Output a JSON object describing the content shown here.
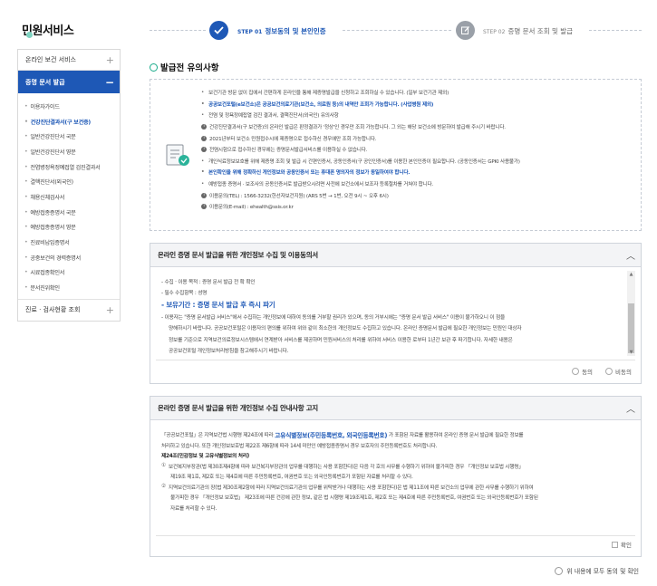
{
  "sidebar": {
    "title": "민원서비스",
    "sections": [
      {
        "label": "온라인 보건 서비스",
        "toggle": "+"
      },
      {
        "label": "증명 문서 발급",
        "toggle": "−"
      },
      {
        "label": "진료 · 검사현황 조회",
        "toggle": "+"
      }
    ],
    "sub_items": [
      "이용자가이드",
      "건강진단결과서(구 보건증)",
      "일반건강진단서 국문",
      "일반건강진단서 영문",
      "전염병정욕정예접열 검진결과서",
      "결핵진단서(외국인)",
      "채용신체검사서",
      "예방접종증명서 국문",
      "예방접종증명서 영문",
      "진료비납입증명서",
      "공중보건의 경력증명서",
      "시료접종확인서",
      "문서진위확인"
    ]
  },
  "steps": [
    {
      "num": "STEP 01",
      "label": "정보동의 및 본인인증"
    },
    {
      "num": "STEP 02",
      "label": "증명 문서 조회 및 발급"
    }
  ],
  "notice": {
    "title": "발급전 유의사항",
    "items": [
      {
        "mark": "•",
        "text": "보건기관 방문 없이 집에서 간편하게 온라인을 통해 제증명발급을 신청하고 조회하실 수 있습니다. (일부 보건기관 제외)"
      },
      {
        "mark": "•",
        "text": "공공보건포털(e보건소)은 공공보건의료기관(보건소, 의료원 등)의 내역만 조회가 가능합니다. (사업병원 제외)",
        "blue": true
      },
      {
        "mark": "•",
        "text": "전염 및 정욕정예접열 검진 결과서, 결핵진단서(외국인) 유의사항"
      },
      {
        "mark": "i",
        "text": "건강진단결과서(구 보건증)의 온라인 발급은 판정결과가 '정상'인 경우만 조회 가능합니다. 그 외는 해당 보건소에 방문하여 발급해 주시기 바랍니다."
      },
      {
        "mark": "i",
        "text": "2021년부터 보건소 민원접수시에 제증명으로 접수하신 경우에만 조회 가능합니다."
      },
      {
        "mark": "i",
        "text": "전염시험으로 접수하신 경우에는 증명문서발급서비스를 이용하실 수 없습니다."
      },
      {
        "mark": "•",
        "text": "개인식료정보보호를 위해 제증명 조회 및 발급 시 간편인증서, 공동인증서(구 공인인증서)를 이용한 본인인증이 필요합니다. (공동인증서는 GPKI 사용불가)"
      },
      {
        "mark": "•",
        "text": "본인확인을 위해 정확하신 개인정보와 공동인증서 또는 휴대폰 명의자의 정보가 동일하여야 합니다.",
        "blue": true
      },
      {
        "mark": "•",
        "text": "예방접종 증명서 · 보조사의 공동인증서로 발급받으시려면 사전에 보건소에서 보조자 등록절차를 거쳐야 합니다."
      },
      {
        "mark": "i",
        "text": "이용문의(TEL) : 1566-3232(한선자보건지원) (ARS 5번 → 1번, 오전 9시 ~ 오후 6시)"
      },
      {
        "mark": "i",
        "text": "이용문의(E-mail) : ehealth@ssis.or.kr"
      }
    ]
  },
  "consent1": {
    "title": "온라인 증명 문서 발급을 위한 개인정보 수집 및 이용동의서",
    "lines": [
      {
        "text": "- 수집 · 이용 목적 : 증명 문서 발급 전 확 확인"
      },
      {
        "text": "- 필수 수집항목 : 성명"
      },
      {
        "text": "- 보유기간 : 증명 문서 발급 후 즉시 파기",
        "big": true
      },
      {
        "text": "- 이용자는 \"증명 문서발급 서비스\"에서 수집하는 개인정보에 대하여 동의를 거부할 권리가 있으며, 동의 거부시에는 \"증명 문서 발급 서비스\" 이용이 불가하오니 이 점을"
      },
      {
        "text": "양해하시기 바랍니다. 공공보건포털은 이용자의 편의를 위하여 위와 같이 최소한의 개인정보도 수집하고 있습니다. 온라인 증명문서 발급에 필요한 개인정보는 민원인 대상자",
        "ind": true
      },
      {
        "text": "정보를 기준으로 지역보건의료정보시스템에서 연계받아 서비스를 제공하며 민원서비스의 처리를 위하여 서비스 이용한 로부터 1년간 보관 후 파기합니다. 자세한 내용은",
        "ind": true
      },
      {
        "text": "공공보건포털 개인정보처리방침을 참고해주시기 바랍니다.",
        "ind": true
      }
    ],
    "options": [
      "동의",
      "비동의"
    ]
  },
  "consent2": {
    "title": "온라인 증명 문서 발급을 위한 개인정보 수집 안내사항 고지",
    "line1_pre": "「공공보건포털」은 지역보건법 시행령 제24조에 따라",
    "line1_hl": "고유식별정보(주민등록번호, 외국인등록번호)",
    "line1_post": "가 포함된 자료를 활용하여 온라인 증명 문서 발급에 필요한 정보를",
    "line2": "처리하고 있습니다. 또한 개인정보보호법 제22조 제6항에 따라 14세 미만인 예방접종증명서 경우 보호자의 주민등록번호도 처리합니다.",
    "line3": "제24조(민감정보 및 고유식별정보의 처리)",
    "items": [
      {
        "n": "①",
        "text": "보건복지부장관(법 제30조제4항에 따라 보건복지부장관의 업무를 대행하는 사용 포함한다)은 다음 각 호의 사무를 수행하기 위하여 불가피한 경우 「개인정보 보호법 시행령」"
      },
      {
        "n": "",
        "text": "제19조 제1호, 제2호 또는 제4호에 따른 주민등록번호, 여권번호 또는 외국인등록번호가 포함된 자료를 처리할 수 있다.",
        "ind": true
      },
      {
        "n": "②",
        "text": "지역보건의료기관의 장(법 제30조제2항에 따라 지역보건의료기관의 업무를 위탁받거나 대행하는 사용 포함한다)은 법 제11조에 따른 보건소의 업무에 관한 사무를 수행하기 위하여"
      },
      {
        "n": "",
        "text": "불가피한 경우 「개인정보 보호법」 제23조에 따른 건강에 관한 정보, 같은 법 시행령 제19조제1호, 제2호 또는 제4호에 따른 주민등록번호, 여권번호 또는 외국인등록번호가 포함된",
        "ind": true
      },
      {
        "n": "",
        "text": "자료를 처리할 수 있다.",
        "ind": true
      }
    ],
    "confirm": "확인"
  },
  "all_agree": "위 내용에 모두 동의 및 확인"
}
